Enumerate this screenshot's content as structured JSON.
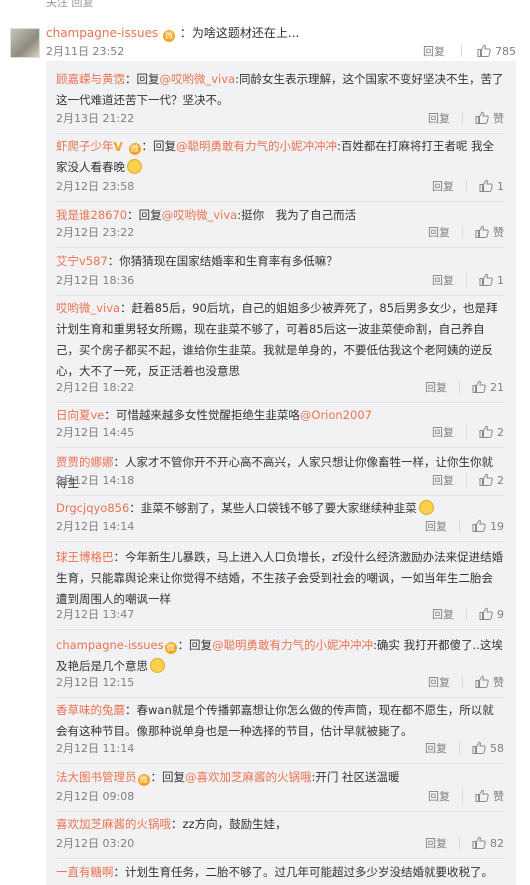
{
  "top_fade": "关注 回复",
  "main_comment": {
    "user": "champagne-issues",
    "badge": "微",
    "text": "：为啥这题材还在上...",
    "date": "2月11日 23:52",
    "reply_label": "回复",
    "likes": "785"
  },
  "replies": [
    {
      "user": "顾嘉嵘与黄霑",
      "pre": "：回复",
      "at": "@哎哟微_viva",
      "text": ":同龄女生表示理解，这个国家不变好坚决不生，苦了这一代难道还苦下一代？坚决不。",
      "date": "2月13日 21:22",
      "reply": "回复",
      "like": "赞"
    },
    {
      "user": "虾爬子少年",
      "vip": "V",
      "badge": "微",
      "pre": "：回复",
      "at": "@聪明勇敢有力气的小妮冲冲冲",
      "text": ":百姓都在打麻将打王者呢 我全家没人看春晚",
      "emoji": "smile",
      "date": "2月12日 23:58",
      "reply": "回复",
      "like": "1"
    },
    {
      "user": "我是谁28670",
      "pre": "：回复",
      "at": "@哎哟微_viva",
      "text": ":挺你　我为了自己而活",
      "date": "2月12日 23:22",
      "reply": "回复",
      "like": "赞"
    },
    {
      "user": "艾宁v587",
      "text": "：你猜猜现在国家结婚率和生育率有多低嘛？",
      "date": "2月12日 18:36",
      "reply": "回复",
      "like": "1"
    },
    {
      "user": "哎哟微_viva",
      "text": "：赶着85后，90后坑，自己的姐姐多少被弄死了，85后男多女少，也是拜计划生育和重男轻女所赐，现在韭菜不够了，可着85后这一波韭菜使命割，自己养自己，买个房子都买不起，谁给你生韭菜。我就是单身的，不要低估我这个老阿姨的逆反心，大不了一死，反正活着也没意思",
      "date": "2月12日 18:22",
      "reply": "回复",
      "like": "21"
    },
    {
      "user": "日向夏ve",
      "text": "：可惜越来越多女性觉醒拒绝生韭菜咯",
      "at2": "@Orion2007",
      "date": "2月12日 14:45",
      "reply": "回复",
      "like": "2"
    },
    {
      "user": "贾贾的娜娜",
      "text": "：人家才不管你开不开心高不高兴，人家只想让你像畜牲一样，让你生你就得生",
      "date": "2月12日 14:18",
      "reply": "回复",
      "like": "2"
    },
    {
      "user": "Drgcjqyo856",
      "text": "：韭菜不够割了，某些人口袋钱不够了要大家继续种韭菜",
      "emoji": "smile",
      "date": "2月12日 14:14",
      "reply": "回复",
      "like": "19"
    },
    {
      "user": "球王博格巴",
      "text": "：今年新生儿暴跌，马上进入人口负增长，zf没什么经济激励办法来促进结婚生育，只能靠舆论来让你觉得不结婚，不生孩子会受到社会的嘲讽，一如当年生二胎会遭到周围人的嘲讽一样",
      "date": "2月12日 13:47",
      "reply": "回复",
      "like": "9"
    },
    {
      "user": "champagne-issues",
      "badge": "微",
      "pre": "：回复",
      "at": "@聪明勇敢有力气的小妮冲冲冲",
      "text": ":确实 我打开都傻了..这埃及艳后是几个意思",
      "emoji": "smile",
      "date": "2月12日 12:15",
      "reply": "回复",
      "like": "赞"
    },
    {
      "user": "香草味的兔蘑",
      "text": "：春wan就是个传播郭嘉想让你怎么做的传声筒，现在都不愿生，所以就会有这种节目。像那种说单身也是一种选择的节目，估计早就被毙了。",
      "date": "2月12日 11:14",
      "reply": "回复",
      "like": "58"
    },
    {
      "user": "法大图书管理员",
      "badge": "微",
      "pre": "：回复",
      "at": "@喜欢加芝麻酱的火锅哦",
      "text": ":开门 社区送温暖",
      "date": "2月12日 09:08",
      "reply": "回复",
      "like": "赞"
    },
    {
      "user": "喜欢加芝麻酱的火锅哦",
      "text": "：zz方向，鼓励生娃，",
      "date": "2月12日 03:20",
      "reply": "回复",
      "like": "82"
    },
    {
      "user": "一直有糖啊",
      "text": "：计划生育任务，二胎不够了。过几年可能超过多少岁没结婚就要收税了。",
      "date": "",
      "reply": "",
      "like": ""
    }
  ],
  "colors": {
    "username": "#eb7350",
    "text": "#333333",
    "meta": "#808080",
    "reply_bg": "#f2f2f5"
  },
  "icons": {
    "like": "thumbs-up-icon",
    "emoji": "smile-emoji-icon",
    "badge": "weibo-member-badge-icon",
    "vip": "verified-v-icon"
  }
}
